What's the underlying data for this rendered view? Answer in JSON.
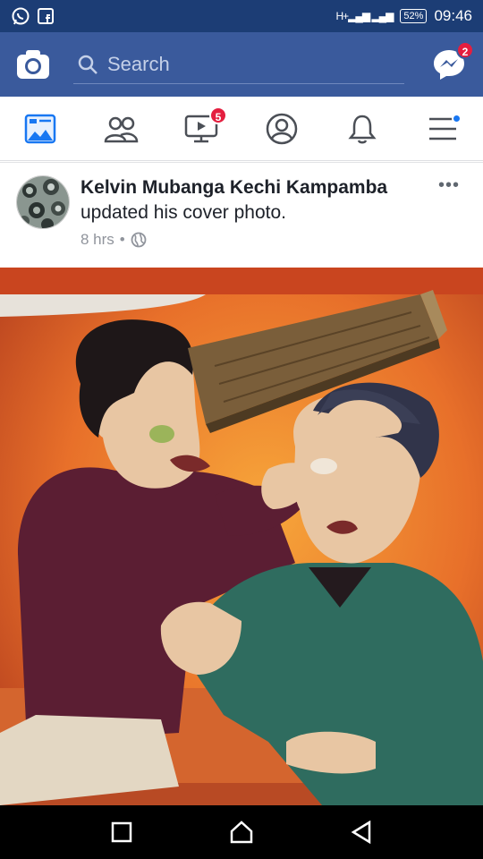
{
  "status_bar": {
    "battery": "52%",
    "time": "09:46",
    "signal_label": "H+"
  },
  "header": {
    "search_placeholder": "Search",
    "messenger_badge": "2"
  },
  "tabs": {
    "watch_badge": "5"
  },
  "post": {
    "author": "Kelvin Mubanga Kechi Kampamba",
    "action": "updated his cover photo.",
    "time": "8 hrs",
    "separator": "•",
    "more": "•••"
  },
  "colors": {
    "status_bar": "#1c3d75",
    "header": "#3a5a9c",
    "accent": "#1877f2",
    "badge": "#e41e3f"
  },
  "icons": {
    "status_left": [
      "whatsapp-icon",
      "facebook-icon"
    ],
    "header": [
      "camera-icon",
      "search-icon",
      "messenger-icon"
    ],
    "tabs": [
      "news-feed-icon",
      "friends-icon",
      "watch-icon",
      "profile-icon",
      "notifications-icon",
      "menu-icon"
    ],
    "nav": [
      "recents-icon",
      "home-icon",
      "back-icon"
    ]
  }
}
